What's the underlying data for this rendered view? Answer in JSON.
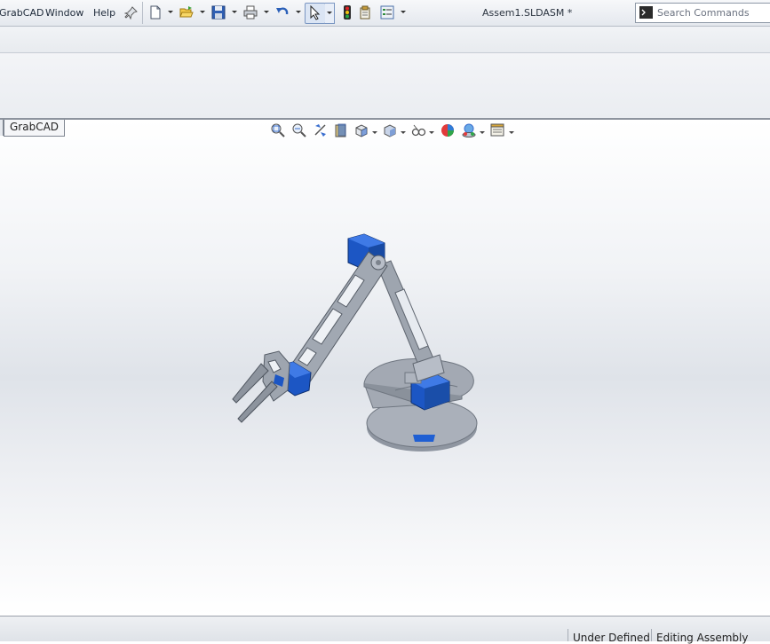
{
  "menubar": {
    "items": [
      "GrabCAD",
      "Window",
      "Help"
    ],
    "document_title": "Assem1.SLDASM *"
  },
  "search": {
    "placeholder": "Search Commands"
  },
  "graphics": {
    "tab_label": "GrabCAD"
  },
  "statusbar": {
    "state": "Under Defined",
    "mode": "Editing Assembly"
  },
  "colors": {
    "part_blue": "#1f5fd3",
    "part_gray": "#9aa1ab",
    "accent": "#2d6bd6"
  }
}
